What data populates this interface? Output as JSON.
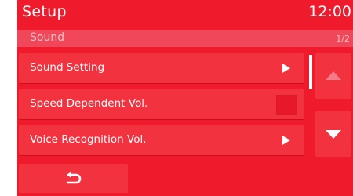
{
  "header": {
    "title": "Setup",
    "time": "12:00"
  },
  "subheader": {
    "section": "Sound",
    "page": "1/2"
  },
  "menu": {
    "items": [
      {
        "label": "Sound Setting",
        "control": "submenu-arrow"
      },
      {
        "label": "Speed Dependent Vol.",
        "control": "checkbox",
        "checked": false
      },
      {
        "label": "Voice Recognition Vol.",
        "control": "submenu-arrow"
      }
    ]
  },
  "scroll": {
    "position": 0.0
  },
  "icons": {
    "up": "triangle-up-icon",
    "down": "triangle-down-icon",
    "back": "back-arrow-icon",
    "submenu": "triangle-right-icon"
  },
  "colors": {
    "background": "#ef1b2d",
    "button": "#f2323f",
    "subheader": "#f0485a",
    "text": "#ffffff",
    "disabled": "#f57b88"
  }
}
